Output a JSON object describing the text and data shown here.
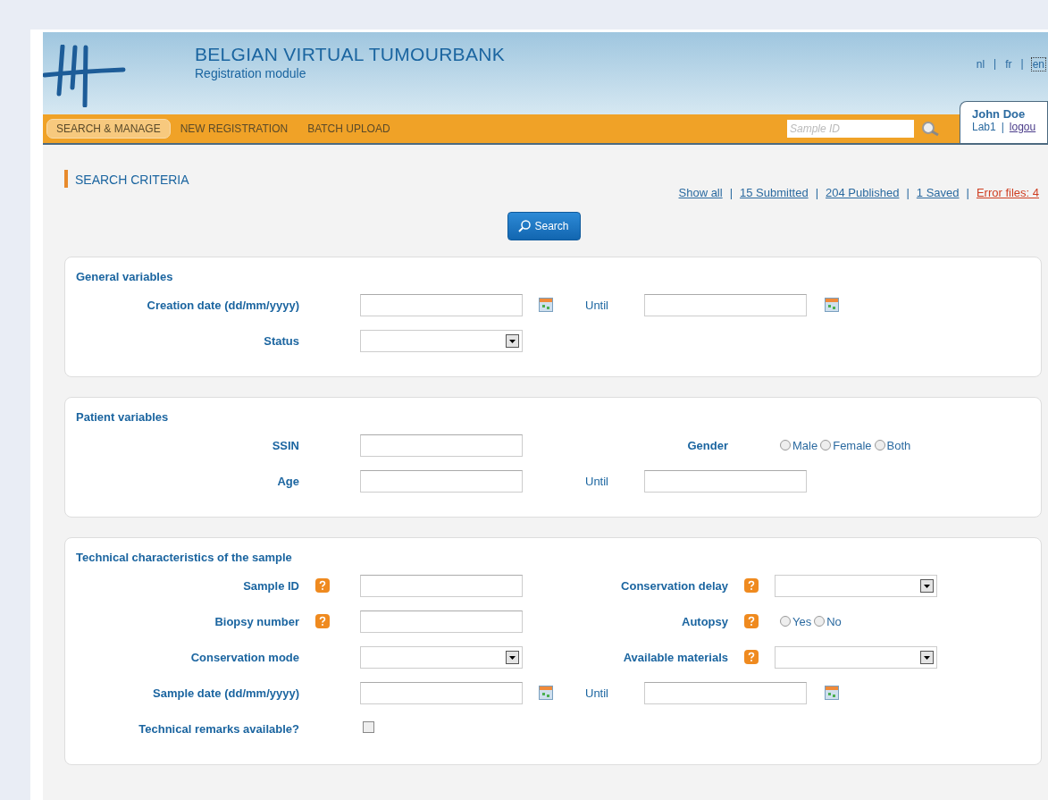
{
  "header": {
    "title": "BELGIAN VIRTUAL TUMOURBANK",
    "subtitle": "Registration module",
    "languages": [
      {
        "label": "nl",
        "selected": false
      },
      {
        "label": "fr",
        "selected": false
      },
      {
        "label": "en",
        "selected": true
      }
    ],
    "language_separators": [
      "|",
      "|"
    ]
  },
  "nav": {
    "items": [
      {
        "label": "SEARCH & MANAGE",
        "selected": true
      },
      {
        "label": "NEW REGISTRATION",
        "selected": false
      },
      {
        "label": "BATCH UPLOAD",
        "selected": false
      }
    ],
    "search": {
      "placeholder": "Sample ID"
    },
    "user": {
      "name": "John Doe",
      "lab": "Lab1",
      "separator": "|",
      "logout": "logou"
    }
  },
  "page_title": "SEARCH CRITERIA",
  "filters": [
    {
      "label": "Show all",
      "kind": "link"
    },
    {
      "label": "15 Submitted",
      "kind": "link"
    },
    {
      "label": "204 Published",
      "kind": "link"
    },
    {
      "label": "1 Saved",
      "kind": "link"
    },
    {
      "label": "Error files: 4",
      "kind": "error"
    }
  ],
  "filter_separators": [
    "|",
    "|",
    "|",
    "|"
  ],
  "search_button": "Search",
  "sections": [
    {
      "title": "General variables",
      "rows": [
        {
          "left": {
            "label": "Creation date (dd/mm/yyyy)",
            "help": false,
            "control": {
              "kind": "date"
            }
          },
          "right": {
            "kind": "until",
            "label": "Until",
            "control": {
              "kind": "date"
            }
          }
        },
        {
          "left": {
            "label": "Status",
            "help": false,
            "control": {
              "kind": "select"
            }
          }
        }
      ]
    },
    {
      "title": "Patient variables",
      "rows": [
        {
          "left": {
            "label": "SSIN",
            "help": false,
            "control": {
              "kind": "text"
            }
          },
          "right": {
            "kind": "field",
            "label": "Gender",
            "help": false,
            "control": {
              "kind": "radio",
              "options": [
                {
                  "label": "Male",
                  "selected": false
                },
                {
                  "label": "Female",
                  "selected": false
                },
                {
                  "label": "Both",
                  "selected": false
                }
              ]
            }
          }
        },
        {
          "left": {
            "label": "Age",
            "help": false,
            "control": {
              "kind": "text"
            }
          },
          "right": {
            "kind": "until",
            "label": "Until",
            "control": {
              "kind": "text"
            }
          }
        }
      ]
    },
    {
      "title": "Technical characteristics of the sample",
      "rows": [
        {
          "left": {
            "label": "Sample ID",
            "help": true,
            "control": {
              "kind": "text"
            }
          },
          "right": {
            "kind": "field",
            "label": "Conservation delay",
            "help": true,
            "control": {
              "kind": "select"
            }
          }
        },
        {
          "left": {
            "label": "Biopsy number",
            "help": true,
            "control": {
              "kind": "text"
            }
          },
          "right": {
            "kind": "field",
            "label": "Autopsy",
            "help": true,
            "control": {
              "kind": "radio",
              "options": [
                {
                  "label": "Yes",
                  "selected": false
                },
                {
                  "label": "No",
                  "selected": false
                }
              ]
            }
          }
        },
        {
          "left": {
            "label": "Conservation mode",
            "help": false,
            "control": {
              "kind": "select"
            }
          },
          "right": {
            "kind": "field",
            "label": "Available materials",
            "help": true,
            "control": {
              "kind": "select"
            }
          }
        },
        {
          "left": {
            "label": "Sample date (dd/mm/yyyy)",
            "help": false,
            "control": {
              "kind": "date"
            }
          },
          "right": {
            "kind": "until",
            "label": "Until",
            "control": {
              "kind": "date"
            }
          }
        },
        {
          "left": {
            "label": "Technical remarks available?",
            "help": false,
            "control": {
              "kind": "checkbox",
              "checked": false
            }
          }
        }
      ]
    }
  ]
}
